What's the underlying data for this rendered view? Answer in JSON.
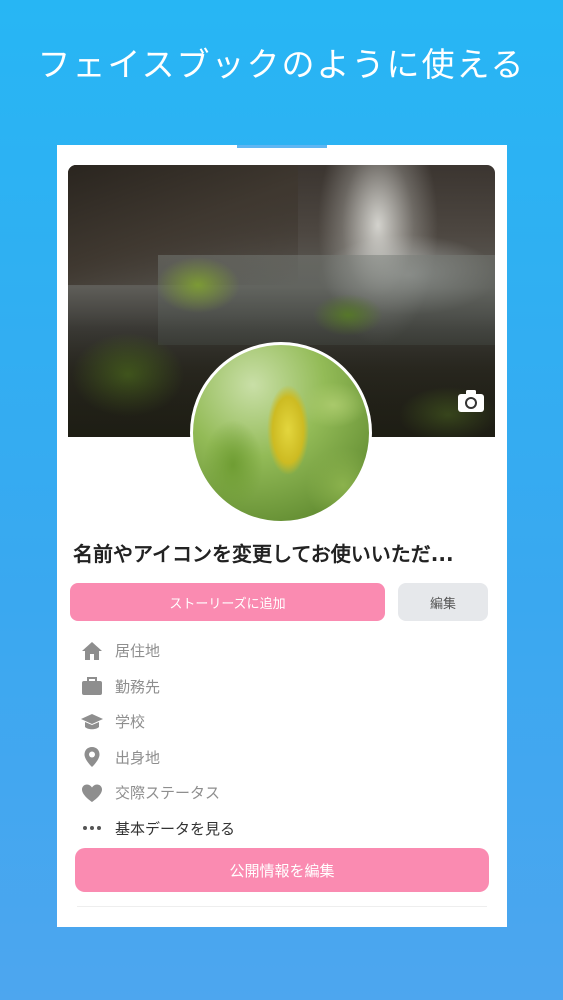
{
  "headline": "フェイスブックのように使える",
  "profile": {
    "name": "名前やアイコンを変更してお使いいただ...",
    "add_story_label": "ストーリーズに追加",
    "edit_label": "編集"
  },
  "info_items": [
    {
      "icon": "home-icon",
      "label": "居住地"
    },
    {
      "icon": "briefcase-icon",
      "label": "勤務先"
    },
    {
      "icon": "graduation-cap-icon",
      "label": "学校"
    },
    {
      "icon": "location-pin-icon",
      "label": "出身地"
    },
    {
      "icon": "heart-icon",
      "label": "交際ステータス"
    },
    {
      "icon": "more-dots-icon",
      "label": "基本データを見る"
    }
  ],
  "edit_public_info_label": "公開情報を編集",
  "colors": {
    "accent_pink": "#fa8bb1",
    "background_blue": "#27b6f4",
    "secondary_button": "#e6e8eb",
    "icon_gray": "#8e8e8e"
  }
}
